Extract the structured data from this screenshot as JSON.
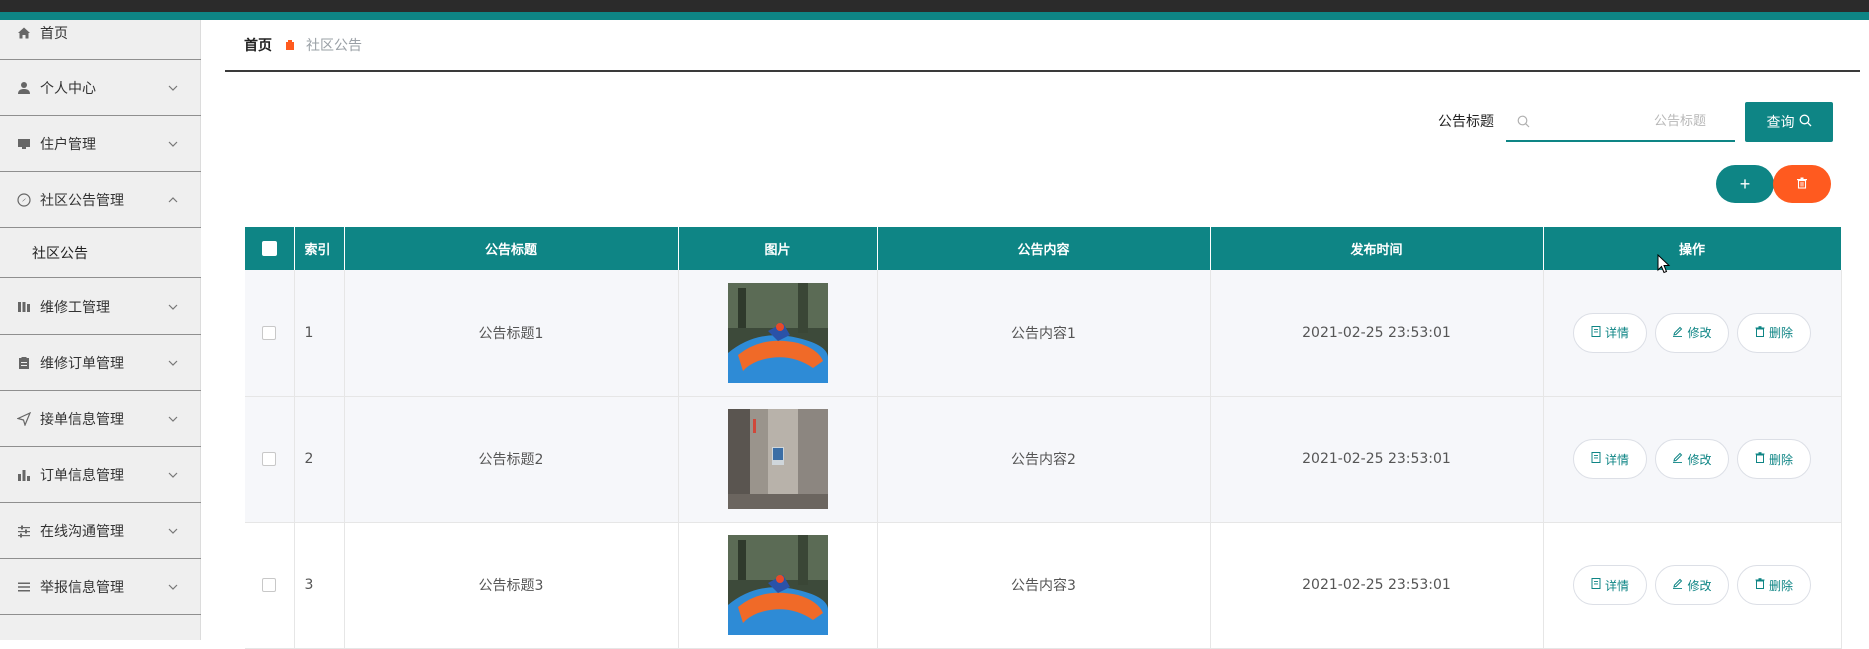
{
  "colors": {
    "accent": "#0e8585",
    "danger": "#ff5a1f",
    "sidebar_bg": "#efefef",
    "topbar": "#2b2b2b"
  },
  "sidebar": {
    "items": [
      {
        "label": "首页",
        "icon": "home-icon",
        "expanded": false,
        "has_arrow": false
      },
      {
        "label": "个人中心",
        "icon": "user-icon",
        "has_arrow": true
      },
      {
        "label": "住户管理",
        "icon": "monitor-icon",
        "has_arrow": true
      },
      {
        "label": "社区公告管理",
        "icon": "compass-icon",
        "has_arrow": true,
        "expanded": true
      },
      {
        "label": "维修工管理",
        "icon": "columns-icon",
        "has_arrow": true
      },
      {
        "label": "维修订单管理",
        "icon": "clipboard-icon",
        "has_arrow": true
      },
      {
        "label": "接单信息管理",
        "icon": "send-icon",
        "has_arrow": true
      },
      {
        "label": "订单信息管理",
        "icon": "bar-chart-icon",
        "has_arrow": true
      },
      {
        "label": "在线沟通管理",
        "icon": "sliders-icon",
        "has_arrow": true
      },
      {
        "label": "举报信息管理",
        "icon": "list-icon",
        "has_arrow": true
      }
    ],
    "subitem": {
      "label": "社区公告"
    }
  },
  "breadcrumb": {
    "home": "首页",
    "current": "社区公告"
  },
  "search": {
    "label": "公告标题",
    "placeholder": "公告标题",
    "value": "",
    "button_label": "查询"
  },
  "toolbar": {
    "add_label": "+",
    "delete_icon": "trash-icon"
  },
  "table": {
    "columns": [
      "索引",
      "公告标题",
      "图片",
      "公告内容",
      "发布时间",
      "操作"
    ],
    "rows": [
      {
        "index": "1",
        "title": "公告标题1",
        "image": "playground",
        "content": "公告内容1",
        "time": "2021-02-25 23:53:01"
      },
      {
        "index": "2",
        "title": "公告标题2",
        "image": "elevator",
        "content": "公告内容2",
        "time": "2021-02-25 23:53:01"
      },
      {
        "index": "3",
        "title": "公告标题3",
        "image": "playground",
        "content": "公告内容3",
        "time": "2021-02-25 23:53:01"
      }
    ],
    "actions": {
      "detail": "详情",
      "edit": "修改",
      "delete": "删除"
    }
  }
}
